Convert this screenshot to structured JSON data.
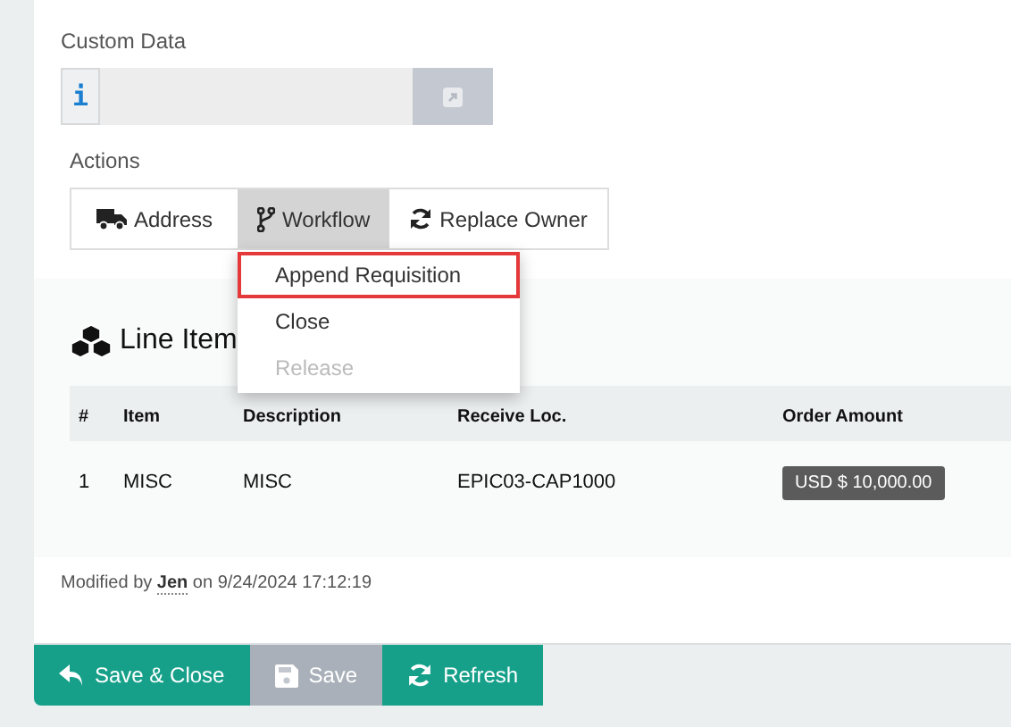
{
  "custom_data": {
    "label": "Custom Data",
    "info_icon": "i"
  },
  "actions": {
    "label": "Actions",
    "buttons": [
      {
        "kind": "truck",
        "label": "Address",
        "selected": false
      },
      {
        "kind": "branch",
        "label": "Workflow",
        "selected": true
      },
      {
        "kind": "refresh",
        "label": "Replace Owner",
        "selected": false
      }
    ]
  },
  "workflow_menu": [
    {
      "label": "Append Requisition",
      "selected": true,
      "disabled": false
    },
    {
      "label": "Close",
      "selected": false,
      "disabled": false
    },
    {
      "label": "Release",
      "selected": false,
      "disabled": true
    }
  ],
  "line_items": {
    "title": "Line Item",
    "columns": [
      "#",
      "Item",
      "Description",
      "Receive Loc.",
      "Order Amount"
    ],
    "rows": [
      {
        "number": "1",
        "item": "MISC",
        "description": "MISC",
        "receive_loc": "EPIC03-CAP1000",
        "order_amount": "USD $ 10,000.00"
      }
    ]
  },
  "modified": "Modified by **Jen** on 9/24/2024 17:12:19",
  "footer_buttons": [
    {
      "kind": "undo",
      "label": "Save & Close",
      "disabled": false
    },
    {
      "kind": "save",
      "label": "Save",
      "disabled": true
    },
    {
      "kind": "refresh",
      "label": "Refresh",
      "disabled": false
    }
  ]
}
